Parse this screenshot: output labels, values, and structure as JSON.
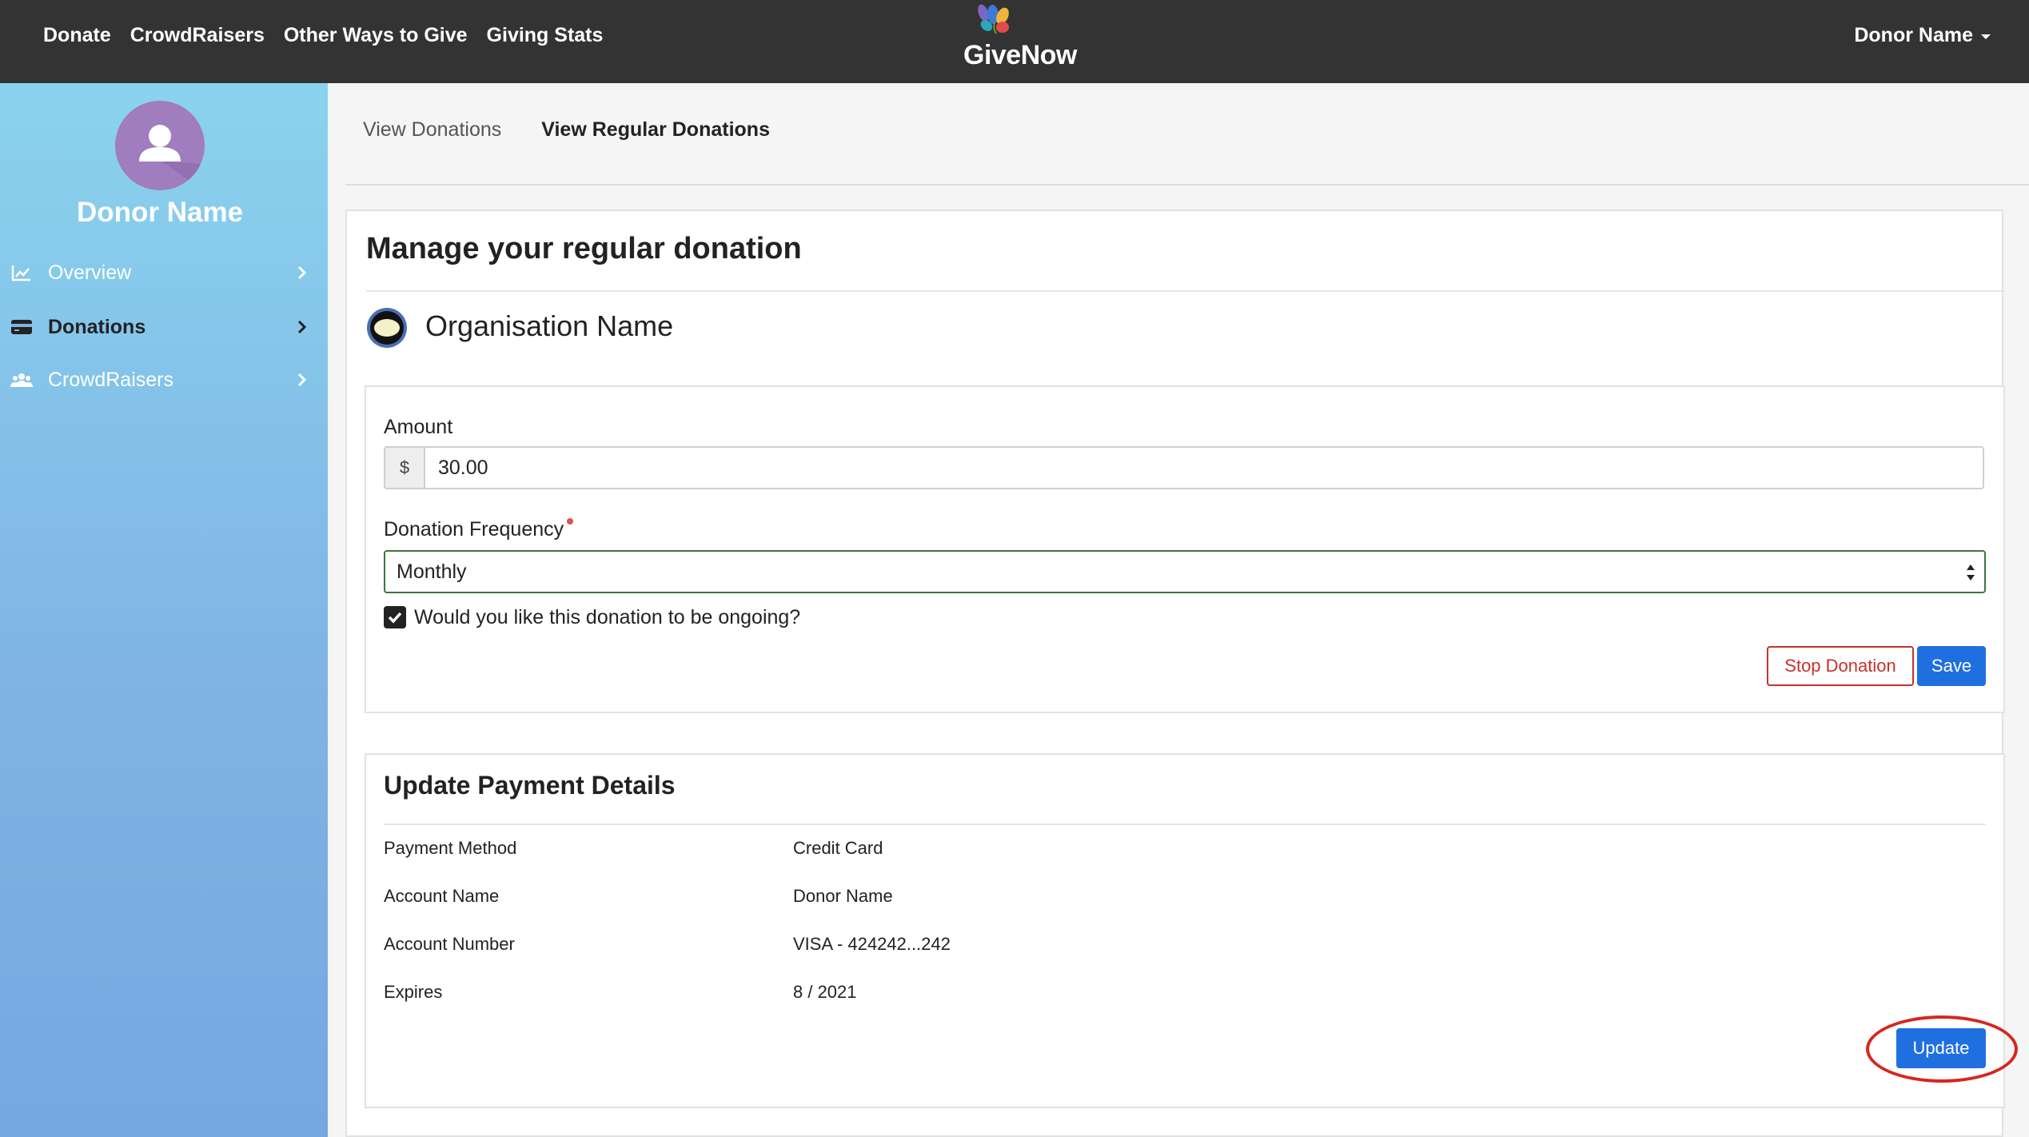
{
  "topnav": {
    "items": [
      "Donate",
      "CrowdRaisers",
      "Other Ways to Give",
      "Giving Stats"
    ],
    "brand": "GiveNow",
    "user_name": "Donor Name"
  },
  "sidebar": {
    "profile_name": "Donor Name",
    "items": [
      {
        "label": "Overview",
        "icon": "line-chart-icon",
        "active": false
      },
      {
        "label": "Donations",
        "icon": "credit-card-icon",
        "active": true
      },
      {
        "label": "CrowdRaisers",
        "icon": "users-icon",
        "active": false
      }
    ]
  },
  "tabs": [
    {
      "label": "View Donations",
      "active": false
    },
    {
      "label": "View Regular Donations",
      "active": true
    }
  ],
  "main": {
    "title": "Manage your regular donation",
    "organisation": "Organisation Name",
    "donation_form": {
      "amount_label": "Amount",
      "currency_symbol": "$",
      "amount_value": "30.00",
      "frequency_label": "Donation Frequency",
      "frequency_value": "Monthly",
      "ongoing_label": "Would you like this donation to be ongoing?",
      "ongoing_checked": true,
      "stop_button": "Stop Donation",
      "save_button": "Save"
    },
    "payment": {
      "title": "Update Payment Details",
      "rows": [
        {
          "label": "Payment Method",
          "value": "Credit Card"
        },
        {
          "label": "Account Name",
          "value": "Donor Name"
        },
        {
          "label": "Account Number",
          "value": "VISA - 424242...242"
        },
        {
          "label": "Expires",
          "value": "8 / 2021"
        }
      ],
      "update_button": "Update"
    }
  },
  "colors": {
    "topbar": "#333333",
    "sidebar_top": "#8ad3ee",
    "sidebar_bottom": "#76a7e0",
    "primary": "#1f6fe0",
    "danger": "#c9302c",
    "highlight": "#d7261f"
  }
}
